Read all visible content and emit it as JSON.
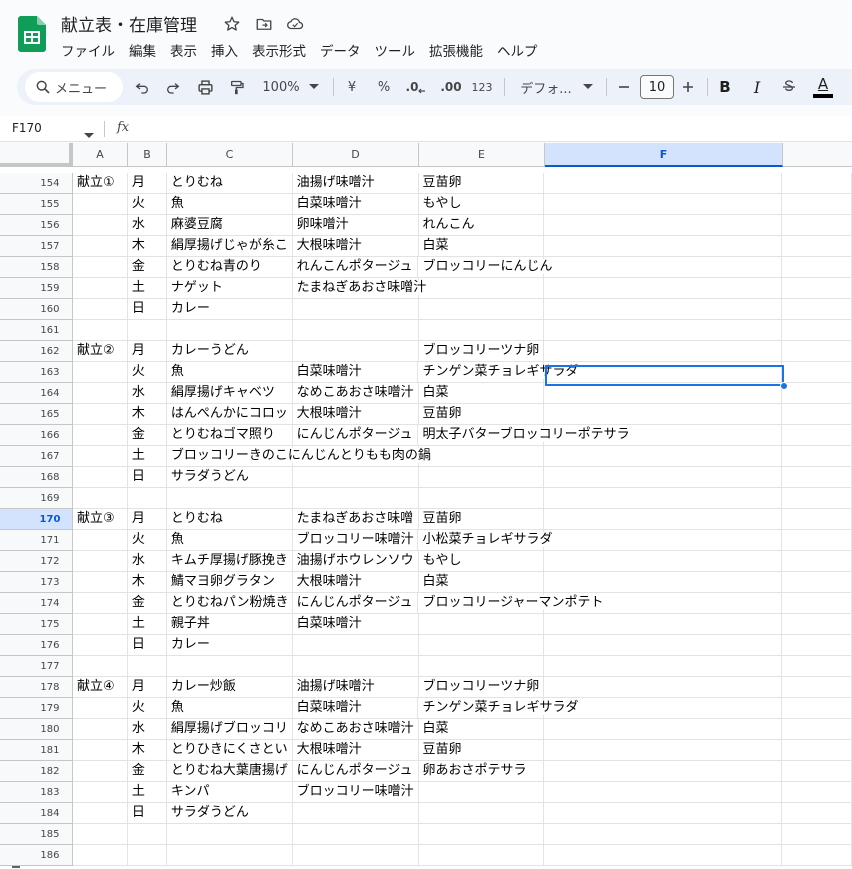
{
  "document": {
    "title": "献立表・在庫管理"
  },
  "menu": [
    "ファイル",
    "編集",
    "表示",
    "挿入",
    "表示形式",
    "データ",
    "ツール",
    "拡張機能",
    "ヘルプ"
  ],
  "toolbar": {
    "search_label": "メニュー",
    "zoom": "100%",
    "currency": "¥",
    "percent": "%",
    "decimal_decrease": ".0",
    "decimal_increase": ".00",
    "number_format": "123",
    "font": "デフォ...",
    "font_size": "10",
    "bold": "B",
    "italic": "I",
    "text_color_label": "A"
  },
  "formula_bar": {
    "cell_ref": "F170",
    "fx": "fx"
  },
  "columns": [
    "A",
    "B",
    "C",
    "D",
    "E",
    "F"
  ],
  "active_column": "F",
  "active_row": "170",
  "rows": [
    {
      "n": "154",
      "cells": [
        "献立①",
        "月",
        "とりむね",
        "油揚げ味噌汁",
        "豆苗卵",
        ""
      ]
    },
    {
      "n": "155",
      "cells": [
        "",
        "火",
        "魚",
        "白菜味噌汁",
        "もやし",
        ""
      ]
    },
    {
      "n": "156",
      "cells": [
        "",
        "水",
        "麻婆豆腐",
        "卵味噌汁",
        "れんこん",
        ""
      ]
    },
    {
      "n": "157",
      "cells": [
        "",
        "木",
        "絹厚揚げじゃが糸こ",
        "大根味噌汁",
        "白菜",
        ""
      ]
    },
    {
      "n": "158",
      "cells": [
        "",
        "金",
        "とりむね青のり",
        "れんこんポタージュ",
        "ブロッコリーにんじん",
        ""
      ]
    },
    {
      "n": "159",
      "cells": [
        "",
        "土",
        "ナゲット",
        "たまねぎあおさ味噌汁",
        "",
        ""
      ]
    },
    {
      "n": "160",
      "cells": [
        "",
        "日",
        "カレー",
        "",
        "",
        ""
      ]
    },
    {
      "n": "161",
      "cells": [
        "",
        "",
        "",
        "",
        "",
        ""
      ]
    },
    {
      "n": "162",
      "cells": [
        "献立②",
        "月",
        "カレーうどん",
        "",
        "ブロッコリーツナ卵",
        ""
      ]
    },
    {
      "n": "163",
      "cells": [
        "",
        "火",
        "魚",
        "白菜味噌汁",
        "チンゲン菜チョレギサラダ",
        ""
      ]
    },
    {
      "n": "164",
      "cells": [
        "",
        "水",
        "絹厚揚げキャベツ",
        "なめこあおさ味噌汁",
        "白菜",
        ""
      ]
    },
    {
      "n": "165",
      "cells": [
        "",
        "木",
        "はんぺんかにコロッ",
        "大根味噌汁",
        "豆苗卵",
        ""
      ]
    },
    {
      "n": "166",
      "cells": [
        "",
        "金",
        "とりむねゴマ照り",
        "にんじんポタージュ",
        "明太子バターブロッコリーポテサラ",
        ""
      ]
    },
    {
      "n": "167",
      "cells": [
        "",
        "土",
        "ブロッコリーきのこにんじんとりもも肉の鍋",
        "",
        "",
        ""
      ]
    },
    {
      "n": "168",
      "cells": [
        "",
        "日",
        "サラダうどん",
        "",
        "",
        ""
      ]
    },
    {
      "n": "169",
      "cells": [
        "",
        "",
        "",
        "",
        "",
        ""
      ]
    },
    {
      "n": "170",
      "cells": [
        "献立③",
        "月",
        "とりむね",
        "たまねぎあおさ味噌",
        "豆苗卵",
        ""
      ]
    },
    {
      "n": "171",
      "cells": [
        "",
        "火",
        "魚",
        "ブロッコリー味噌汁",
        "小松菜チョレギサラダ",
        ""
      ]
    },
    {
      "n": "172",
      "cells": [
        "",
        "水",
        "キムチ厚揚げ豚挽き",
        "油揚げホウレンソウ",
        "もやし",
        ""
      ]
    },
    {
      "n": "173",
      "cells": [
        "",
        "木",
        "鯖マヨ卵グラタン",
        "大根味噌汁",
        "白菜",
        ""
      ]
    },
    {
      "n": "174",
      "cells": [
        "",
        "金",
        "とりむねパン粉焼き",
        "にんじんポタージュ",
        "ブロッコリージャーマンポテト",
        ""
      ]
    },
    {
      "n": "175",
      "cells": [
        "",
        "土",
        "親子丼",
        "白菜味噌汁",
        "",
        ""
      ]
    },
    {
      "n": "176",
      "cells": [
        "",
        "日",
        "カレー",
        "",
        "",
        ""
      ]
    },
    {
      "n": "177",
      "cells": [
        "",
        "",
        "",
        "",
        "",
        ""
      ]
    },
    {
      "n": "178",
      "cells": [
        "献立④",
        "月",
        "カレー炒飯",
        "油揚げ味噌汁",
        "ブロッコリーツナ卵",
        ""
      ]
    },
    {
      "n": "179",
      "cells": [
        "",
        "火",
        "魚",
        "白菜味噌汁",
        "チンゲン菜チョレギサラダ",
        ""
      ]
    },
    {
      "n": "180",
      "cells": [
        "",
        "水",
        "絹厚揚げブロッコリ",
        "なめこあおさ味噌汁",
        "白菜",
        ""
      ]
    },
    {
      "n": "181",
      "cells": [
        "",
        "木",
        "とりひきにくさとい",
        "大根味噌汁",
        "豆苗卵",
        ""
      ]
    },
    {
      "n": "182",
      "cells": [
        "",
        "金",
        "とりむね大葉唐揚げ",
        "にんじんポタージュ",
        "卵あおさポテサラ",
        ""
      ]
    },
    {
      "n": "183",
      "cells": [
        "",
        "土",
        "キンパ",
        "ブロッコリー味噌汁",
        "",
        ""
      ]
    },
    {
      "n": "184",
      "cells": [
        "",
        "日",
        "サラダうどん",
        "",
        "",
        ""
      ]
    },
    {
      "n": "185",
      "cells": [
        "",
        "",
        "",
        "",
        "",
        ""
      ]
    },
    {
      "n": "186",
      "cells": [
        "",
        "",
        "",
        "",
        "",
        ""
      ]
    }
  ],
  "colors": {
    "accent": "#1a73e8",
    "sheets_green": "#0f9d58",
    "header_bg": "#f8f9fa",
    "active_header_bg": "#d3e3fd"
  }
}
